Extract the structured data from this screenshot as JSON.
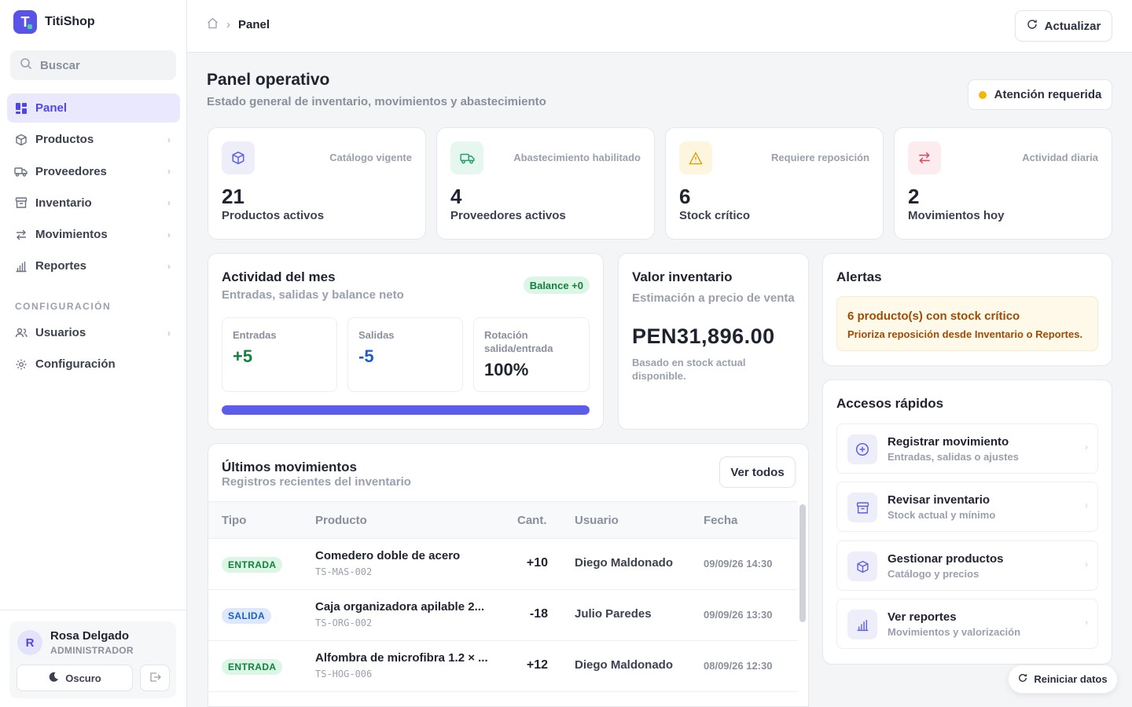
{
  "brand": {
    "name": "TitiShop"
  },
  "search": {
    "placeholder": "Buscar"
  },
  "sidebar": {
    "items": [
      {
        "label": "Panel",
        "icon": "grid-icon"
      },
      {
        "label": "Productos",
        "icon": "box-icon"
      },
      {
        "label": "Proveedores",
        "icon": "truck-icon"
      },
      {
        "label": "Inventario",
        "icon": "archive-icon"
      },
      {
        "label": "Movimientos",
        "icon": "arrows-icon"
      },
      {
        "label": "Reportes",
        "icon": "chart-icon"
      }
    ],
    "section_title": "CONFIGURACIÓN",
    "config_items": [
      {
        "label": "Usuarios",
        "icon": "users-icon"
      },
      {
        "label": "Configuración",
        "icon": "gear-icon"
      }
    ]
  },
  "user": {
    "initial": "R",
    "name": "Rosa Delgado",
    "role": "ADMINISTRADOR",
    "theme_label": "Oscuro"
  },
  "topbar": {
    "breadcrumb": "Panel",
    "refresh_label": "Actualizar"
  },
  "header": {
    "title": "Panel operativo",
    "subtitle": "Estado general de inventario, movimientos y abastecimiento",
    "attention_label": "Atención requerida"
  },
  "stats": [
    {
      "caption": "Catálogo vigente",
      "value": "21",
      "label": "Productos activos",
      "icon": "box-icon",
      "color": "#5b5ce8",
      "bg": "#eeeefb"
    },
    {
      "caption": "Abastecimiento habilitado",
      "value": "4",
      "label": "Proveedores activos",
      "icon": "truck-icon",
      "color": "#22a06b",
      "bg": "#e6f7ef"
    },
    {
      "caption": "Requiere reposición",
      "value": "6",
      "label": "Stock crítico",
      "icon": "warning-icon",
      "color": "#d99a00",
      "bg": "#fdf5de"
    },
    {
      "caption": "Actividad diaria",
      "value": "2",
      "label": "Movimientos hoy",
      "icon": "arrows-icon",
      "color": "#e0455b",
      "bg": "#fdecef"
    }
  ],
  "activity": {
    "title": "Actividad del mes",
    "subtitle": "Entradas, salidas y balance neto",
    "balance": "Balance +0",
    "entradas_label": "Entradas",
    "entradas_value": "+5",
    "salidas_label": "Salidas",
    "salidas_value": "-5",
    "rotacion_label_1": "Rotación",
    "rotacion_label_2": "salida/entrada",
    "rotacion_value": "100%",
    "progress": 1.0
  },
  "valor": {
    "title": "Valor inventario",
    "subtitle": "Estimación a precio de venta",
    "amount": "PEN31,896.00",
    "note": "Basado en stock actual disponible."
  },
  "alertas": {
    "title": "Alertas",
    "alert_title": "6 producto(s) con stock crítico",
    "alert_text": "Prioriza reposición desde Inventario o Reportes."
  },
  "quick": {
    "title": "Accesos rápidos",
    "items": [
      {
        "title": "Registrar movimiento",
        "sub": "Entradas, salidas o ajustes",
        "icon": "plus-circle-icon"
      },
      {
        "title": "Revisar inventario",
        "sub": "Stock actual y mínimo",
        "icon": "archive-icon"
      },
      {
        "title": "Gestionar productos",
        "sub": "Catálogo y precios",
        "icon": "box-icon"
      },
      {
        "title": "Ver reportes",
        "sub": "Movimientos y valorización",
        "icon": "chart-icon"
      }
    ]
  },
  "movements": {
    "title": "Últimos movimientos",
    "subtitle": "Registros recientes del inventario",
    "see_all": "Ver todos",
    "columns": [
      "Tipo",
      "Producto",
      "Cant.",
      "Usuario",
      "Fecha"
    ],
    "rows": [
      {
        "type": "ENTRADA",
        "product": "Comedero doble de acero",
        "sku": "TS-MAS-002",
        "qty": "+10",
        "user": "Diego Maldonado",
        "date": "09/09/26 14:30"
      },
      {
        "type": "SALIDA",
        "product": "Caja organizadora apilable 2...",
        "sku": "TS-ORG-002",
        "qty": "-18",
        "user": "Julio Paredes",
        "date": "09/09/26 13:30"
      },
      {
        "type": "ENTRADA",
        "product": "Alfombra de microfibra 1.2 × ...",
        "sku": "TS-HOG-006",
        "qty": "+12",
        "user": "Diego Maldonado",
        "date": "08/09/26 12:30"
      }
    ]
  },
  "reset_label": "Reiniciar datos"
}
